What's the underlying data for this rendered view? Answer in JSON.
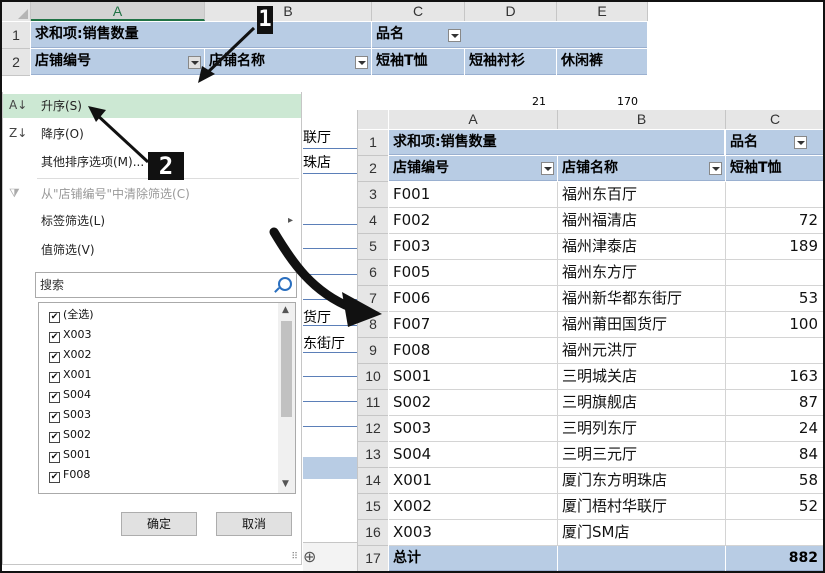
{
  "back_sheet": {
    "col_headers": [
      "A",
      "B",
      "C",
      "D",
      "E"
    ],
    "row_headers": [
      "1",
      "2"
    ],
    "row1_a": "求和项:销售数量",
    "row1_c": "品名",
    "row2_a": "店铺编号",
    "row2_b": "店铺名称",
    "row2_c": "短袖T恤",
    "row2_d": "短袖衬衫",
    "row2_e": "休闲裤",
    "partial_values": [
      "21",
      "170"
    ],
    "partial_texts": [
      "联厅",
      "珠店",
      "货厅",
      "东街厅"
    ]
  },
  "menu": {
    "items": [
      {
        "label": "升序(S)",
        "icon": "sort-asc-icon",
        "highlight": true
      },
      {
        "label": "降序(O)",
        "icon": "sort-desc-icon"
      },
      {
        "label": "其他排序选项(M)..."
      },
      {
        "label": "从\"店铺编号\"中清除筛选(C)",
        "icon": "clear-filter-icon",
        "disabled": true
      },
      {
        "label": "标签筛选(L)",
        "submenu": true
      },
      {
        "label": "值筛选(V)",
        "submenu": true
      }
    ],
    "search_placeholder": "搜索",
    "list_items": [
      "(全选)",
      "X003",
      "X002",
      "X001",
      "S004",
      "S003",
      "S002",
      "S001",
      "F008"
    ],
    "ok_label": "确定",
    "cancel_label": "取消"
  },
  "badges": {
    "one": "1",
    "two": "2"
  },
  "front_sheet": {
    "col_headers": [
      "A",
      "B",
      "C"
    ],
    "header_row1": {
      "a": "求和项:销售数量",
      "c": "品名"
    },
    "header_row2": {
      "a": "店铺编号",
      "b": "店铺名称",
      "c": "短袖T恤"
    },
    "rows": [
      {
        "n": "3",
        "id": "F001",
        "name": "福州东百厅",
        "val": ""
      },
      {
        "n": "4",
        "id": "F002",
        "name": "福州福清店",
        "val": "72"
      },
      {
        "n": "5",
        "id": "F003",
        "name": "福州津泰店",
        "val": "189"
      },
      {
        "n": "6",
        "id": "F005",
        "name": "福州东方厅",
        "val": ""
      },
      {
        "n": "7",
        "id": "F006",
        "name": "福州新华都东街厅",
        "val": "53"
      },
      {
        "n": "8",
        "id": "F007",
        "name": "福州莆田国货厅",
        "val": "100"
      },
      {
        "n": "9",
        "id": "F008",
        "name": "福州元洪厅",
        "val": ""
      },
      {
        "n": "10",
        "id": "S001",
        "name": "三明城关店",
        "val": "163"
      },
      {
        "n": "11",
        "id": "S002",
        "name": "三明旗舰店",
        "val": "87"
      },
      {
        "n": "12",
        "id": "S003",
        "name": "三明列东厅",
        "val": "24"
      },
      {
        "n": "13",
        "id": "S004",
        "name": "三明三元厅",
        "val": "84"
      },
      {
        "n": "14",
        "id": "X001",
        "name": "厦门东方明珠店",
        "val": "58"
      },
      {
        "n": "15",
        "id": "X002",
        "name": "厦门梧村华联厅",
        "val": "52"
      },
      {
        "n": "16",
        "id": "X003",
        "name": "厦门SM店",
        "val": ""
      }
    ],
    "total": {
      "n": "17",
      "label": "总计",
      "val": "882"
    }
  },
  "colors": {
    "pivot_header": "#b8cce4",
    "menu_highlight": "#cce8d3",
    "accent": "#217346"
  }
}
